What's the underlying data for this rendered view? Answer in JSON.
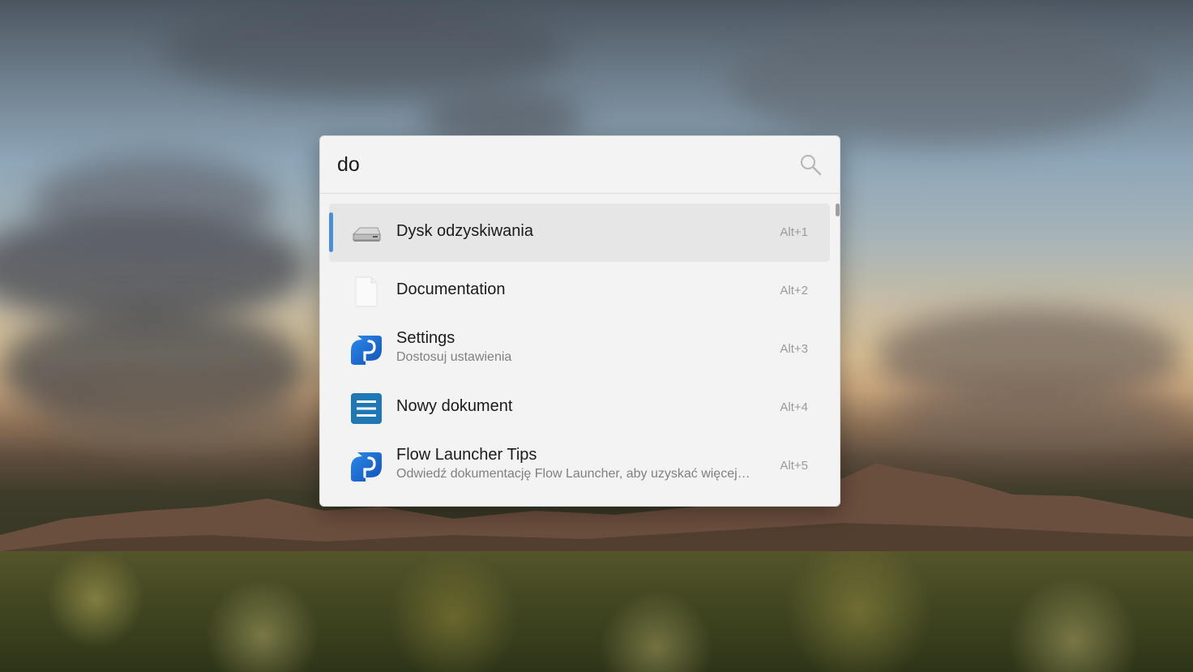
{
  "search": {
    "query": "do"
  },
  "results": [
    {
      "title": "Dysk odzyskiwania",
      "subtitle": "",
      "hotkey": "Alt+1",
      "icon": "drive-icon",
      "selected": true
    },
    {
      "title": "Documentation",
      "subtitle": "",
      "hotkey": "Alt+2",
      "icon": "blank-file-icon",
      "selected": false
    },
    {
      "title": "Settings",
      "subtitle": "Dostosuj ustawienia",
      "hotkey": "Alt+3",
      "icon": "flow-launcher-icon",
      "selected": false
    },
    {
      "title": "Nowy dokument",
      "subtitle": "",
      "hotkey": "Alt+4",
      "icon": "document-lines-icon",
      "selected": false
    },
    {
      "title": "Flow Launcher Tips",
      "subtitle": "Odwiedź dokumentację Flow Launcher, aby uzyskać więcej…",
      "hotkey": "Alt+5",
      "icon": "flow-launcher-icon",
      "selected": false
    }
  ],
  "colors": {
    "accent": "#4a90d9",
    "flow_blue": "#1e6fd9",
    "doc_blue": "#1f78b4"
  }
}
